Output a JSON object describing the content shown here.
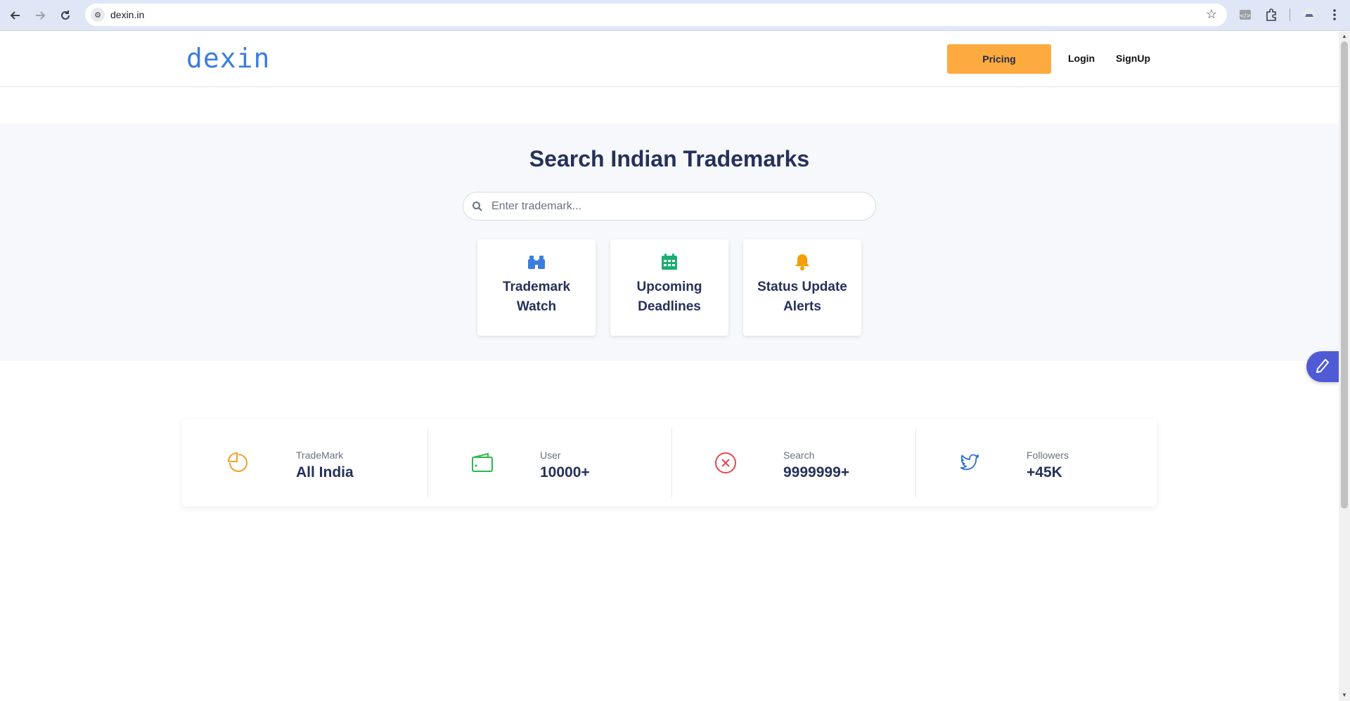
{
  "browser": {
    "url": "dexin.in",
    "back_icon": "arrow-left-icon",
    "forward_icon": "arrow-right-icon",
    "reload_icon": "reload-icon",
    "bookmark_icon": "star-icon"
  },
  "header": {
    "logo": "dexin",
    "pricing_label": "Pricing",
    "login_label": "Login",
    "signup_label": "SignUp",
    "colors": {
      "logo": "#3b7dde",
      "pricing_bg": "#fdaa3f"
    }
  },
  "hero": {
    "title": "Search Indian Trademarks",
    "search_placeholder": "Enter trademark...",
    "cards": [
      {
        "label": "Trademark\nWatch",
        "icon": "binoculars-icon",
        "color": "#3b7dde"
      },
      {
        "label": "Upcoming\nDeadlines",
        "icon": "calendar-icon",
        "color": "#1aae6f"
      },
      {
        "label": "Status Update\nAlerts",
        "icon": "bell-icon",
        "color": "#f59f0a"
      }
    ]
  },
  "stats": [
    {
      "label": "TradeMark",
      "value": "All India",
      "icon": "pie-chart-icon",
      "color": "#f59f2a"
    },
    {
      "label": "User",
      "value": "10000+",
      "icon": "wallet-icon",
      "color": "#2eb84a"
    },
    {
      "label": "Search",
      "value": "9999999+",
      "icon": "x-circle-icon",
      "color": "#e5484d"
    },
    {
      "label": "Followers",
      "value": "+45K",
      "icon": "twitter-icon",
      "color": "#2f6fd8"
    }
  ],
  "floating_button": {
    "icon": "pencil-icon"
  }
}
